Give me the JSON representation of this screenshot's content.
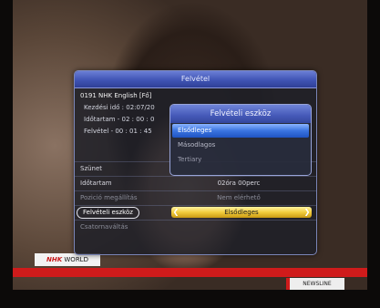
{
  "dialog": {
    "title": "Felvétel",
    "channel": "0191  NHK English [Fő]",
    "start_time": "Kezdési idő : 02:07/20",
    "duration": "Időtartam - 02 : 00 : 0",
    "recording": "Felvétel - 00 : 01 : 45"
  },
  "rows": [
    {
      "label": "Szünet",
      "value": ""
    },
    {
      "label": "Időtartam",
      "value": "02óra 00perc"
    },
    {
      "label": "Pozició megállítás",
      "value": "Nem elérhető"
    },
    {
      "label": "Felvételi eszköz",
      "value": "Elsődleges"
    },
    {
      "label": "Csatornaváltás",
      "value": ""
    }
  ],
  "popup": {
    "title": "Felvételi eszköz",
    "options": [
      "Elsődleges",
      "Másodlagos",
      "Tertiary"
    ],
    "selected": "Elsődleges"
  },
  "overlay": {
    "nhk_brand": "NHK",
    "nhk_world": "WORLD",
    "newsline": "NEWSLINE"
  },
  "colors": {
    "accent": "#4054b4",
    "highlight": "#f2cc3c",
    "active_option": "#3a74e0",
    "news_red": "#cf1b1b"
  }
}
